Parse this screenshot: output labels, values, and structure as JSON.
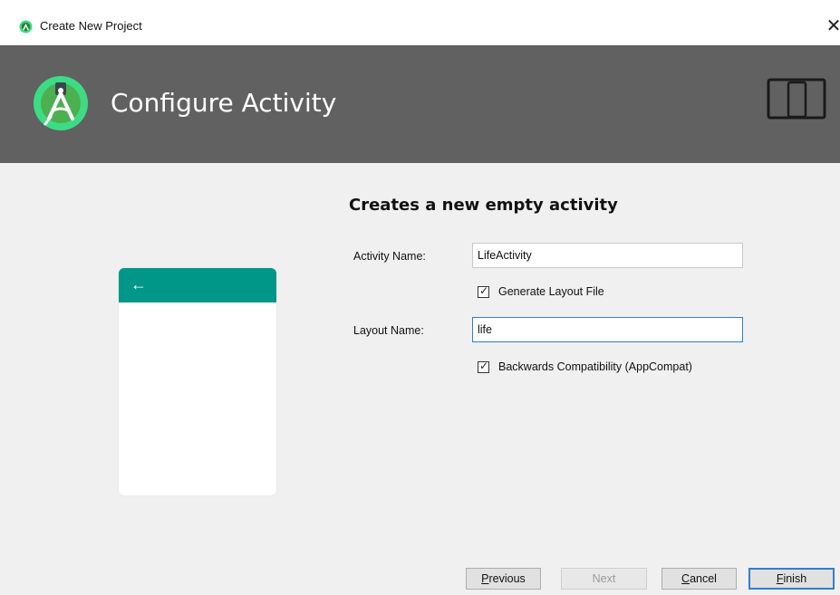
{
  "window": {
    "title": "Create New Project",
    "close_glyph": "✕"
  },
  "header": {
    "title": "Configure Activity",
    "logo_icon": "android-studio-logo-icon",
    "device_icon": "phone-tablet-icon",
    "background_color": "#616161"
  },
  "main": {
    "subtitle": "Creates a new empty activity",
    "preview": {
      "appbar_color": "#009688",
      "back_arrow": "←"
    },
    "fields": {
      "activity_name_label": "Activity Name:",
      "activity_name_value": "LifeActivity",
      "layout_name_label": "Layout Name:",
      "layout_name_value": "life"
    },
    "checkboxes": {
      "generate_layout": {
        "label": "Generate Layout File",
        "checked": true
      },
      "backwards_compat": {
        "label": "Backwards Compatibility (AppCompat)",
        "checked": true
      }
    }
  },
  "buttons": {
    "previous": {
      "mnemonic": "P",
      "rest": "revious"
    },
    "next": {
      "label": "Next",
      "enabled": false
    },
    "cancel": {
      "mnemonic": "C",
      "rest": "ancel"
    },
    "finish": {
      "mnemonic": "F",
      "rest": "inish"
    },
    "focus_color": "#2f7fd1"
  }
}
